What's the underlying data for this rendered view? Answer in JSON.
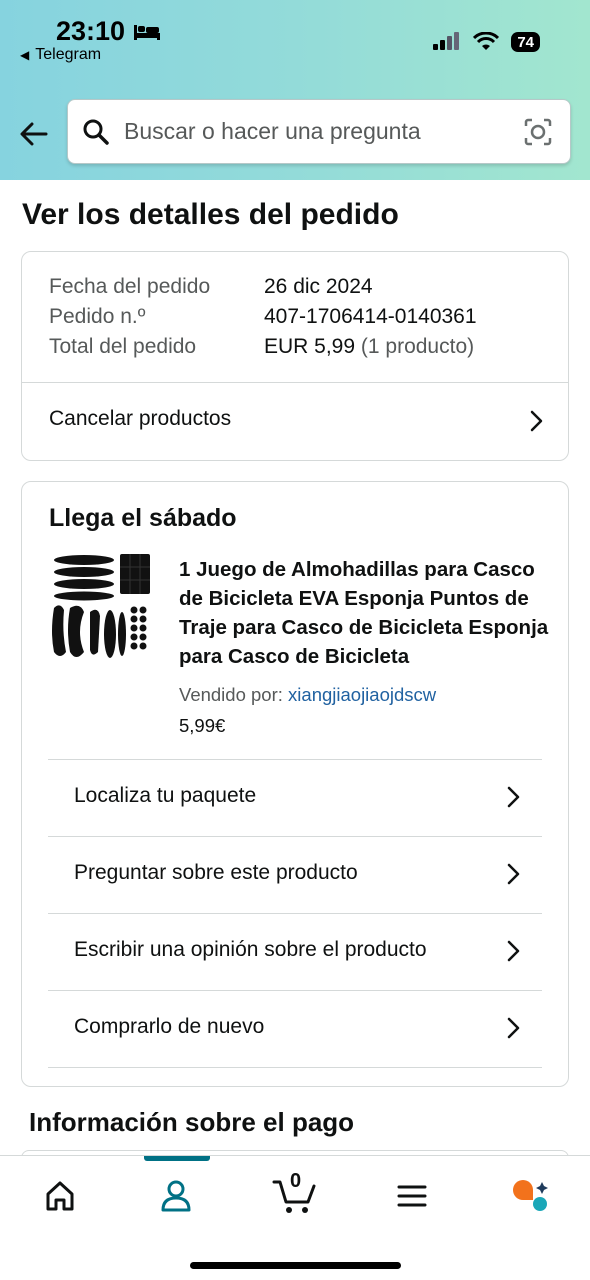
{
  "status_bar": {
    "time": "23:10",
    "back_app": "Telegram",
    "battery": "74"
  },
  "search": {
    "placeholder": "Buscar o hacer una pregunta"
  },
  "page_title": "Ver los detalles del pedido",
  "order_summary": {
    "rows": [
      {
        "label": "Fecha del pedido",
        "value": "26 dic 2024"
      },
      {
        "label": "Pedido n.º",
        "value": "407-1706414-0140361"
      },
      {
        "label": "Total del pedido",
        "value": "EUR 5,99",
        "note": "(1 producto)"
      }
    ],
    "cancel_label": "Cancelar productos"
  },
  "shipment": {
    "arrival": "Llega el sábado",
    "product_title": "1 Juego de Almohadillas para Casco de Bicicleta EVA Esponja Puntos de Traje para Casco de Bicicleta Esponja para Casco de Bicicleta",
    "sold_by_label": "Vendido por:",
    "seller": "xiangjiaojiaojdscw",
    "price": "5,99€",
    "actions": [
      "Localiza tu paquete",
      "Preguntar sobre este producto",
      "Escribir una opinión sobre el producto",
      "Comprarlo de nuevo"
    ]
  },
  "payment_section_title": "Información sobre el pago",
  "tabbar": {
    "tabs": [
      {
        "name": "home",
        "icon": "home-icon"
      },
      {
        "name": "account",
        "icon": "user-icon",
        "active": true
      },
      {
        "name": "cart",
        "icon": "cart-icon",
        "count": "0"
      },
      {
        "name": "menu",
        "icon": "menu-icon"
      },
      {
        "name": "rufus",
        "icon": "rufus-ai-icon"
      }
    ]
  },
  "colors": {
    "accent": "#007185",
    "link": "#2162a1",
    "header_start": "#86d3df",
    "header_end": "#a2e6cf"
  }
}
